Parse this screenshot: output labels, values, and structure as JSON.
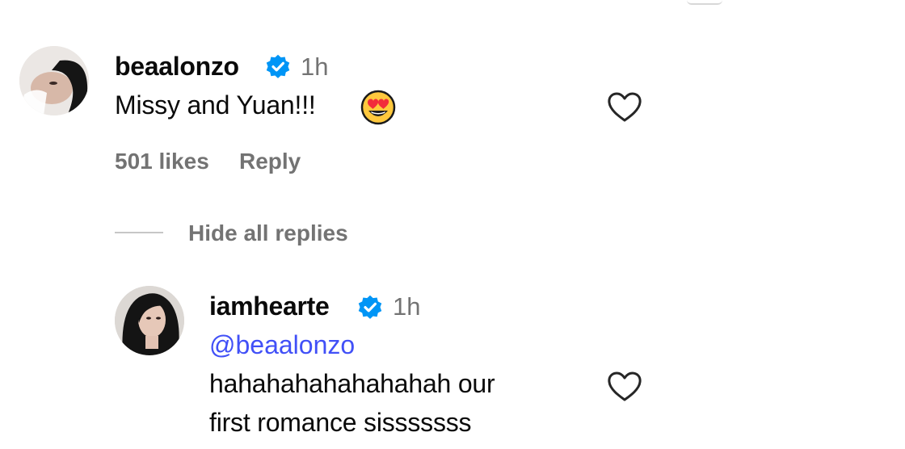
{
  "comments": [
    {
      "username": "beaalonzo",
      "time": "1h",
      "text": "Missy and Yuan!!!",
      "emoji": "heart-eyes-emoji",
      "likes": "501 likes",
      "reply_label": "Reply"
    }
  ],
  "replies_toggle": {
    "label": "Hide all replies"
  },
  "replies": [
    {
      "username": "iamhearte",
      "time": "1h",
      "mention": "@beaalonzo",
      "text_line_1": "hahahahahahahahah our",
      "text_line_2": "first romance sisssssss"
    }
  ],
  "colors": {
    "verified_badge": "#0095f6",
    "mention": "#4150f7",
    "secondary_text": "#737373"
  }
}
